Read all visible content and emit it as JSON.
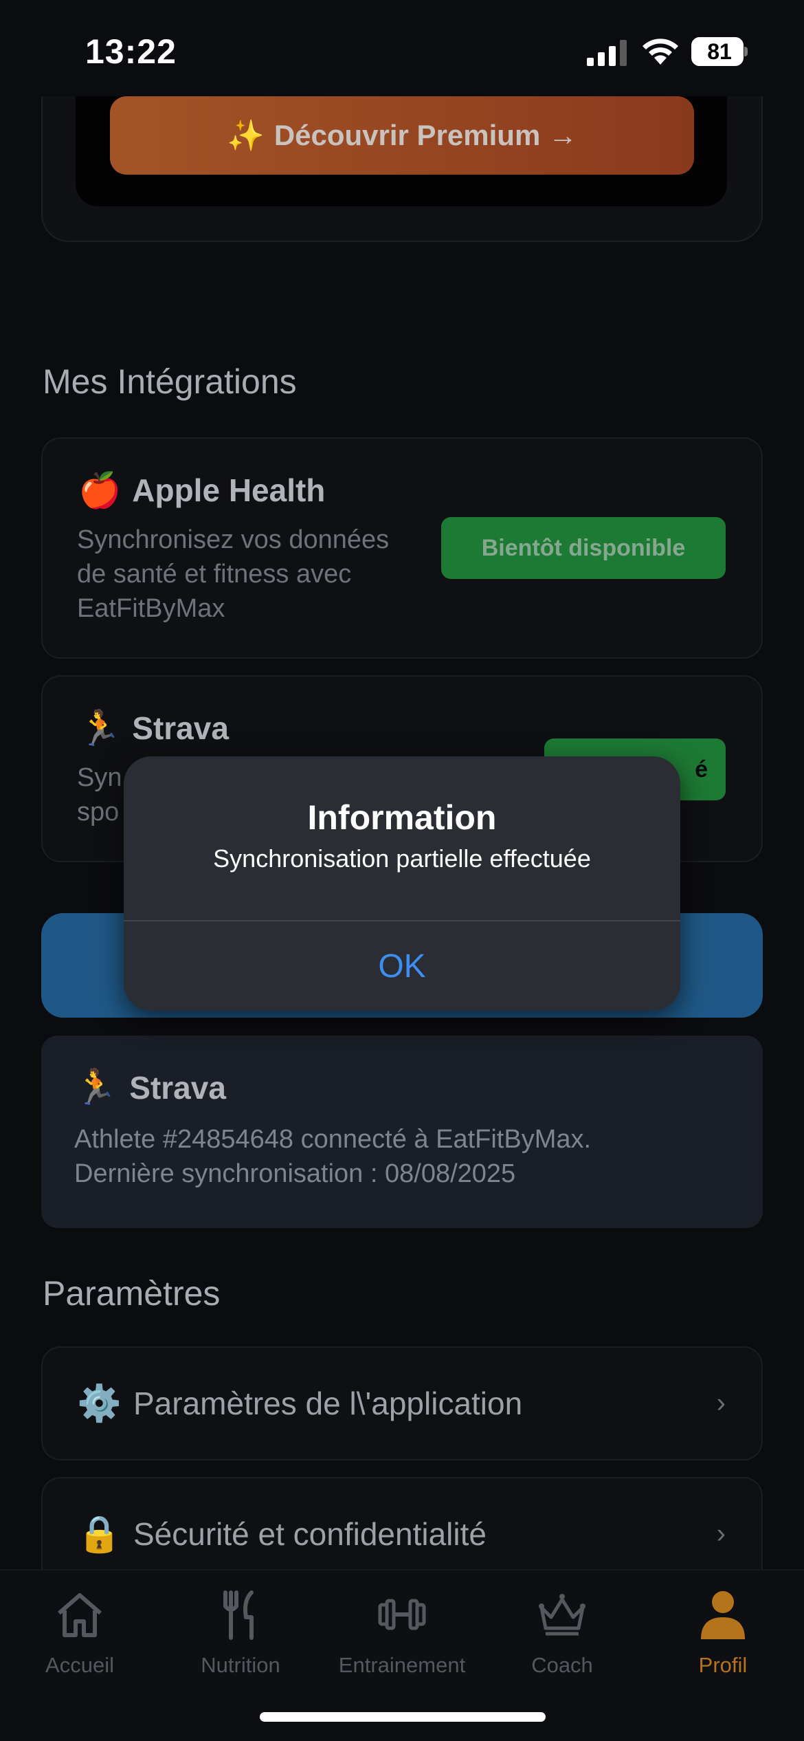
{
  "status_bar": {
    "time": "13:22",
    "battery_level": "81",
    "signal_icon": "cellular-signal-icon",
    "wifi_icon": "wifi-icon"
  },
  "premium": {
    "sparkle_icon": "✨",
    "button_label": "Découvrir Premium →"
  },
  "integrations": {
    "section_title": "Mes Intégrations",
    "apple_health": {
      "emoji": "🍎",
      "title": "Apple Health",
      "description_lines": [
        "Synchronisez vos données",
        "de santé et fitness avec",
        "EatFitByMax"
      ],
      "button_label": "Bientôt disponible"
    },
    "strava": {
      "emoji": "🏃",
      "title": "Strava",
      "description_partial_1": "Syn",
      "description_partial_2": "spo",
      "button_label_partial": "é"
    }
  },
  "strava_status": {
    "emoji": "🏃",
    "title": "Strava",
    "line1": "Athlete #24854648 connecté à EatFitByMax.",
    "line2": "Dernière synchronisation : 08/08/2025"
  },
  "settings": {
    "section_title": "Paramètres",
    "items": [
      {
        "icon": "⚙️",
        "label": "Paramètres de l\\'application",
        "chevron": "›"
      },
      {
        "icon": "🔒",
        "label": "Sécurité et confidentialité",
        "chevron": "›"
      }
    ]
  },
  "tab_bar": {
    "tabs": [
      {
        "label": "Accueil",
        "icon": "home-icon"
      },
      {
        "label": "Nutrition",
        "icon": "fork-knife-icon"
      },
      {
        "label": "Entrainement",
        "icon": "dumbbell-icon"
      },
      {
        "label": "Coach",
        "icon": "crown-icon"
      },
      {
        "label": "Profil",
        "icon": "person-icon"
      }
    ],
    "active_tab": "Profil",
    "active_color": "#b5731b"
  },
  "alert": {
    "title": "Information",
    "message": "Synchronisation partielle effectuée",
    "ok_label": "OK"
  }
}
